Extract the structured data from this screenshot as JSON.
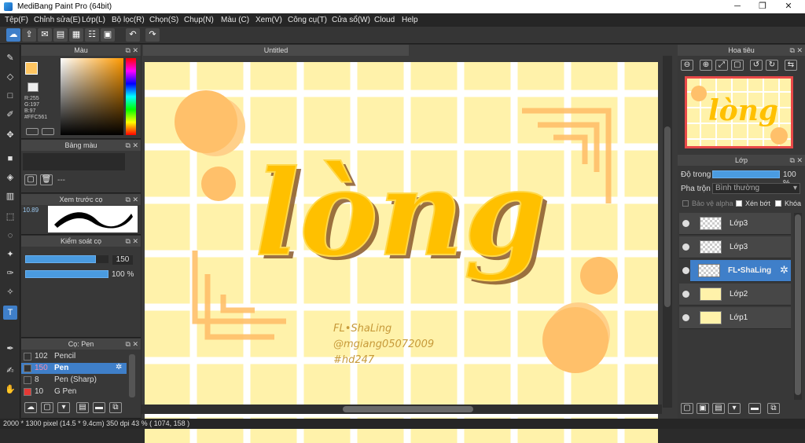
{
  "window": {
    "title": "MediBang Paint Pro (64bit)",
    "minimize": "─",
    "maximize": "❐",
    "close": "✕"
  },
  "menu": [
    "Tệp(F)",
    "Chỉnh sửa(E)",
    "Lớp(L)",
    "Bộ lọc(R)",
    "Chọn(S)",
    "Chụp(N)",
    "Màu (C)",
    "Xem(V)",
    "Công cụ(T)",
    "Cửa sổ(W)",
    "Cloud",
    "Help"
  ],
  "color_panel": {
    "title": "Màu",
    "r": "R:255",
    "g": "G:197",
    "b": "B:97",
    "hex": "#FFC561",
    "primary": "#FFC561",
    "secondary": "#FFFFFF"
  },
  "palette_panel": {
    "title": "Bảng màu",
    "none": "---"
  },
  "brush_preview": {
    "title": "Xem trước cọ",
    "size": "10.89"
  },
  "brush_control": {
    "title": "Kiểm soát cọ",
    "size": "150",
    "opacity": "100 %",
    "size_fraction": 0.85,
    "opacity_fraction": 1.0
  },
  "brush_list": {
    "title": "Cọ: Pen",
    "items": [
      {
        "size": "102",
        "name": "Pencil",
        "color": "#333333",
        "selected": false
      },
      {
        "size": "150",
        "name": "Pen",
        "color": "#333333",
        "selected": true
      },
      {
        "size": "8",
        "name": "Pen (Sharp)",
        "color": "#333333",
        "selected": false
      },
      {
        "size": "10",
        "name": "G Pen",
        "color": "#e53935",
        "selected": false
      }
    ]
  },
  "document": {
    "tab": "Untitled"
  },
  "canvas_text": {
    "line1": "FL•ShaLing",
    "line2": "@mgiang05072009",
    "line3": "#hd247"
  },
  "navigator": {
    "title": "Hoa tiêu"
  },
  "layers_panel": {
    "title": "Lớp",
    "opacity_label": "Độ trong",
    "opacity_value": "100 %",
    "opacity_fraction": 1.0,
    "blend_label": "Pha trộn",
    "blend_value": "Bình thường",
    "protect_alpha": "Bảo vệ alpha",
    "clipping": "Xén bớt",
    "lock": "Khóa",
    "items": [
      {
        "name": "Lớp3",
        "selected": false
      },
      {
        "name": "Lớp3",
        "selected": false
      },
      {
        "name": "FL•ShaLing",
        "selected": true
      },
      {
        "name": "Lớp2",
        "selected": false
      },
      {
        "name": "Lớp1",
        "selected": false
      }
    ]
  },
  "status": {
    "text": "2000 * 1300 pixel   (14.5 * 9.4cm)   350 dpi   43 %   ( 1074, 158 )"
  }
}
